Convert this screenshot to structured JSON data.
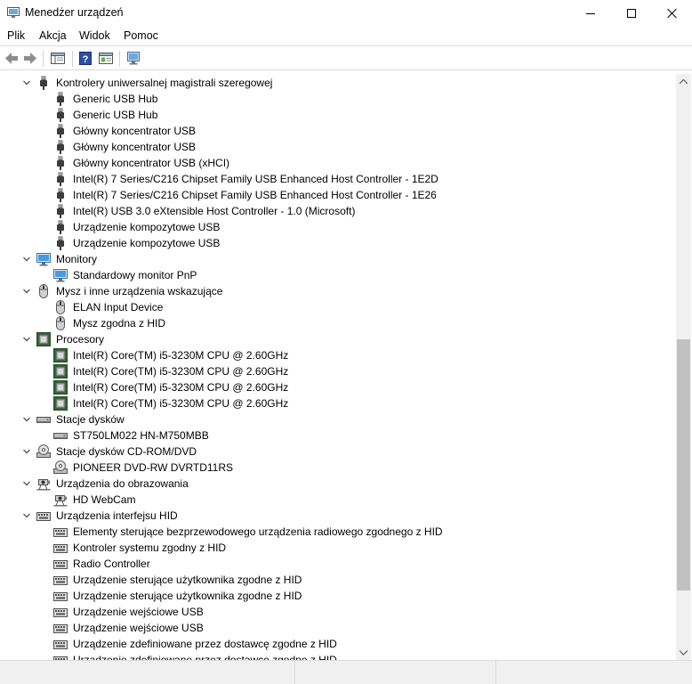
{
  "window": {
    "title": "Menedżer urządzeń"
  },
  "menu": [
    "Plik",
    "Akcja",
    "Widok",
    "Pomoc"
  ],
  "toolbar": [
    "back-icon",
    "forward-icon",
    "show-hide-console-tree-icon",
    "help-icon",
    "properties-icon",
    "scan-hardware-icon"
  ],
  "tree": [
    {
      "level": 0,
      "label": "Kontrolery uniwersalnej magistrali szeregowej",
      "icon": "usb"
    },
    {
      "level": 1,
      "label": "Generic USB Hub",
      "icon": "usb"
    },
    {
      "level": 1,
      "label": "Generic USB Hub",
      "icon": "usb"
    },
    {
      "level": 1,
      "label": "Główny koncentrator USB",
      "icon": "usb"
    },
    {
      "level": 1,
      "label": "Główny koncentrator USB",
      "icon": "usb"
    },
    {
      "level": 1,
      "label": "Główny koncentrator USB (xHCI)",
      "icon": "usb"
    },
    {
      "level": 1,
      "label": "Intel(R) 7 Series/C216 Chipset Family USB Enhanced Host Controller - 1E2D",
      "icon": "usb"
    },
    {
      "level": 1,
      "label": "Intel(R) 7 Series/C216 Chipset Family USB Enhanced Host Controller - 1E26",
      "icon": "usb"
    },
    {
      "level": 1,
      "label": "Intel(R) USB 3.0 eXtensible Host Controller - 1.0 (Microsoft)",
      "icon": "usb"
    },
    {
      "level": 1,
      "label": "Urządzenie kompozytowe USB",
      "icon": "usb"
    },
    {
      "level": 1,
      "label": "Urządzenie kompozytowe USB",
      "icon": "usb"
    },
    {
      "level": 0,
      "label": "Monitory",
      "icon": "monitor"
    },
    {
      "level": 1,
      "label": "Standardowy monitor PnP",
      "icon": "monitor"
    },
    {
      "level": 0,
      "label": "Mysz i inne urządzenia wskazujące",
      "icon": "mouse"
    },
    {
      "level": 1,
      "label": "ELAN Input Device",
      "icon": "mouse"
    },
    {
      "level": 1,
      "label": "Mysz zgodna z HID",
      "icon": "mouse"
    },
    {
      "level": 0,
      "label": "Procesory",
      "icon": "cpu"
    },
    {
      "level": 1,
      "label": "Intel(R) Core(TM) i5-3230M CPU @ 2.60GHz",
      "icon": "cpu"
    },
    {
      "level": 1,
      "label": "Intel(R) Core(TM) i5-3230M CPU @ 2.60GHz",
      "icon": "cpu"
    },
    {
      "level": 1,
      "label": "Intel(R) Core(TM) i5-3230M CPU @ 2.60GHz",
      "icon": "cpu"
    },
    {
      "level": 1,
      "label": "Intel(R) Core(TM) i5-3230M CPU @ 2.60GHz",
      "icon": "cpu"
    },
    {
      "level": 0,
      "label": "Stacje dysków",
      "icon": "disk"
    },
    {
      "level": 1,
      "label": "ST750LM022 HN-M750MBB",
      "icon": "disk"
    },
    {
      "level": 0,
      "label": "Stacje dysków CD-ROM/DVD",
      "icon": "cdrom"
    },
    {
      "level": 1,
      "label": "PIONEER DVD-RW  DVRTD11RS",
      "icon": "cdrom"
    },
    {
      "level": 0,
      "label": "Urządzenia do obrazowania",
      "icon": "camera"
    },
    {
      "level": 1,
      "label": "HD WebCam",
      "icon": "camera"
    },
    {
      "level": 0,
      "label": "Urządzenia interfejsu HID",
      "icon": "hid"
    },
    {
      "level": 1,
      "label": "Elementy sterujące bezprzewodowego urządzenia radiowego zgodnego z HID",
      "icon": "hid"
    },
    {
      "level": 1,
      "label": "Kontroler systemu zgodny z HID",
      "icon": "hid"
    },
    {
      "level": 1,
      "label": "Radio Controller",
      "icon": "hid"
    },
    {
      "level": 1,
      "label": "Urządzenie sterujące użytkownika zgodne z HID",
      "icon": "hid"
    },
    {
      "level": 1,
      "label": "Urządzenie sterujące użytkownika zgodne z HID",
      "icon": "hid"
    },
    {
      "level": 1,
      "label": "Urządzenie wejściowe USB",
      "icon": "hid"
    },
    {
      "level": 1,
      "label": "Urządzenie wejściowe USB",
      "icon": "hid"
    },
    {
      "level": 1,
      "label": "Urządzenie zdefiniowane przez dostawcę zgodne z HID",
      "icon": "hid"
    },
    {
      "level": 1,
      "label": "Urządzenie zdefiniowane przez dostawcę zgodne z HID",
      "icon": "hid"
    }
  ]
}
